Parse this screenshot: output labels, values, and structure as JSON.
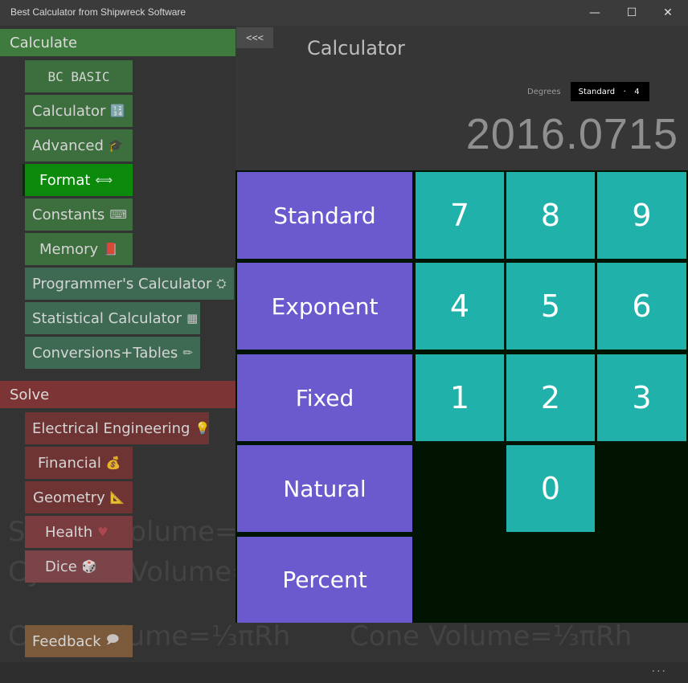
{
  "window": {
    "title": "Best Calculator from Shipwreck Software",
    "minimize_glyph": "—",
    "maximize_glyph": "☐",
    "close_glyph": "✕"
  },
  "background_formulas": [
    "Cone Volume=⅓πRh",
    "Cone Volume=⅓πRh",
    "Cylinder Volume=πR²h",
    "Sphere Volume=⅓πR³",
    "Cone Volume=⅓πRh"
  ],
  "sidebar": {
    "calculate_header": "Calculate",
    "solve_header": "Solve",
    "calculate_items": [
      {
        "label": "BC BASIC",
        "icon": ""
      },
      {
        "label": "Calculator",
        "icon": "🔢"
      },
      {
        "label": "Advanced",
        "icon": "🎓"
      },
      {
        "label": "Format",
        "icon": "⟺"
      },
      {
        "label": "Constants",
        "icon": "⌨"
      },
      {
        "label": "Memory",
        "icon": "📕"
      },
      {
        "label": "Programmer's Calculator",
        "icon": "⛭"
      },
      {
        "label": "Statistical Calculator",
        "icon": "▦"
      },
      {
        "label": "Conversions+Tables",
        "icon": "✏"
      }
    ],
    "solve_items": [
      {
        "label": "Electrical Engineering",
        "icon": "💡"
      },
      {
        "label": "Financial",
        "icon": "💰"
      },
      {
        "label": "Geometry",
        "icon": "📐"
      },
      {
        "label": "Health",
        "icon": "♥"
      },
      {
        "label": "Dice",
        "icon": "🎲"
      }
    ],
    "feedback": {
      "label": "Feedback",
      "icon": "🗩"
    },
    "collapse_label": "<<<"
  },
  "calculator": {
    "page_title": "Calculator",
    "angle_mode": "Degrees",
    "format_mode": "Standard",
    "digits": "4",
    "display_value": "2016.0715"
  },
  "format_keys": [
    "Standard",
    "Exponent",
    "Fixed",
    "Natural",
    "Percent"
  ],
  "digit_keys": [
    "7",
    "8",
    "9",
    "4",
    "5",
    "6",
    "1",
    "2",
    "3",
    "0"
  ],
  "colors": {
    "format_key": "#6a5acd",
    "digit_key": "#20b2aa",
    "keypad_background": "#011301",
    "calculate_green": "#3f7b3f",
    "format_active": "#0b8a0b",
    "solve_red": "#7d3434"
  },
  "status": {
    "more_glyph": "···"
  }
}
